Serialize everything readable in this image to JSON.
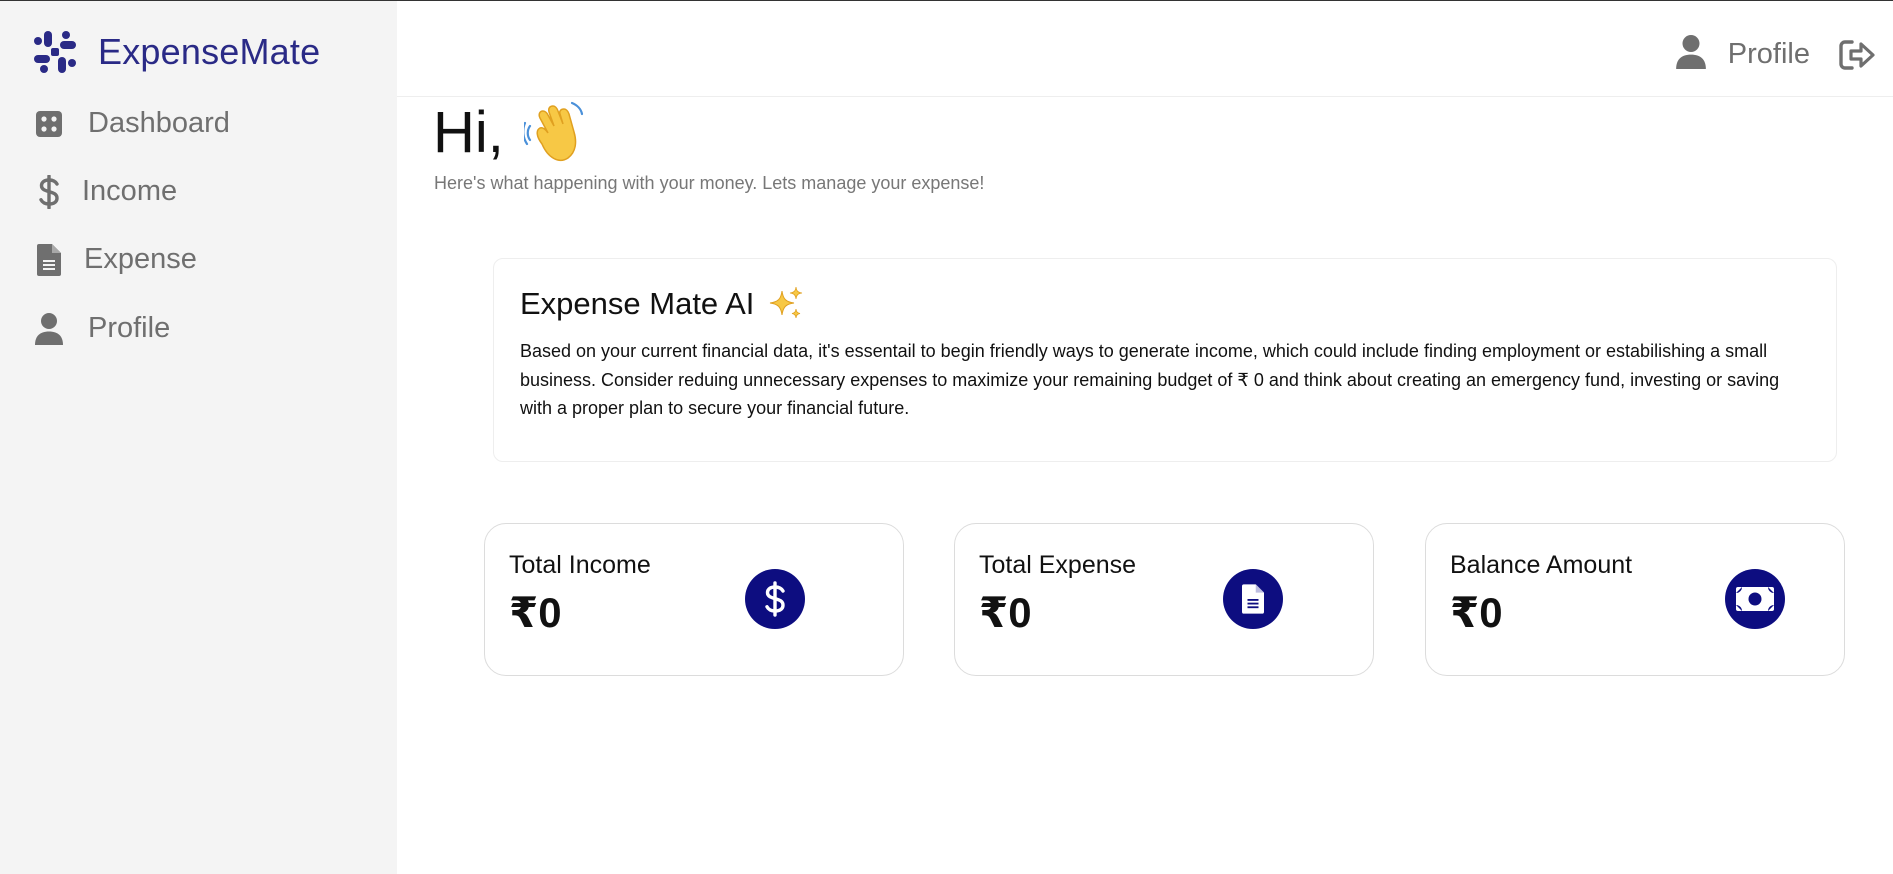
{
  "app": {
    "brand": "ExpenseMate"
  },
  "sidebar": {
    "items": [
      {
        "label": "Dashboard",
        "icon": "dashboard-icon"
      },
      {
        "label": "Income",
        "icon": "dollar-icon"
      },
      {
        "label": "Expense",
        "icon": "document-icon"
      },
      {
        "label": "Profile",
        "icon": "user-icon"
      }
    ]
  },
  "header": {
    "profile_label": "Profile",
    "profile_icon": "user-icon",
    "logout_icon": "logout-icon"
  },
  "greeting": {
    "title": "Hi,",
    "emoji": "waving-hand",
    "subtitle": "Here's what happening with your money. Lets manage your expense!"
  },
  "ai_card": {
    "title": "Expense Mate AI",
    "emoji": "sparkles",
    "text": "Based on your current financial data, it's essentail to begin friendly ways to generate income, which could include finding employment or estabilishing a small business. Consider reduing unnecessary expenses to maximize your remaining budget of ₹ 0 and think about creating an emergency fund, investing or saving with a proper plan to secure your financial future."
  },
  "stats": [
    {
      "label": "Total Income",
      "value": "₹0",
      "icon": "dollar-icon"
    },
    {
      "label": "Total Expense",
      "value": "₹0",
      "icon": "document-icon"
    },
    {
      "label": "Balance Amount",
      "value": "₹0",
      "icon": "money-bill-icon"
    }
  ],
  "colors": {
    "brand": "#2a2a86",
    "icon_circle": "#0d0d80",
    "sidebar_bg": "#f4f4f4",
    "muted_text": "#6f6f6f"
  }
}
